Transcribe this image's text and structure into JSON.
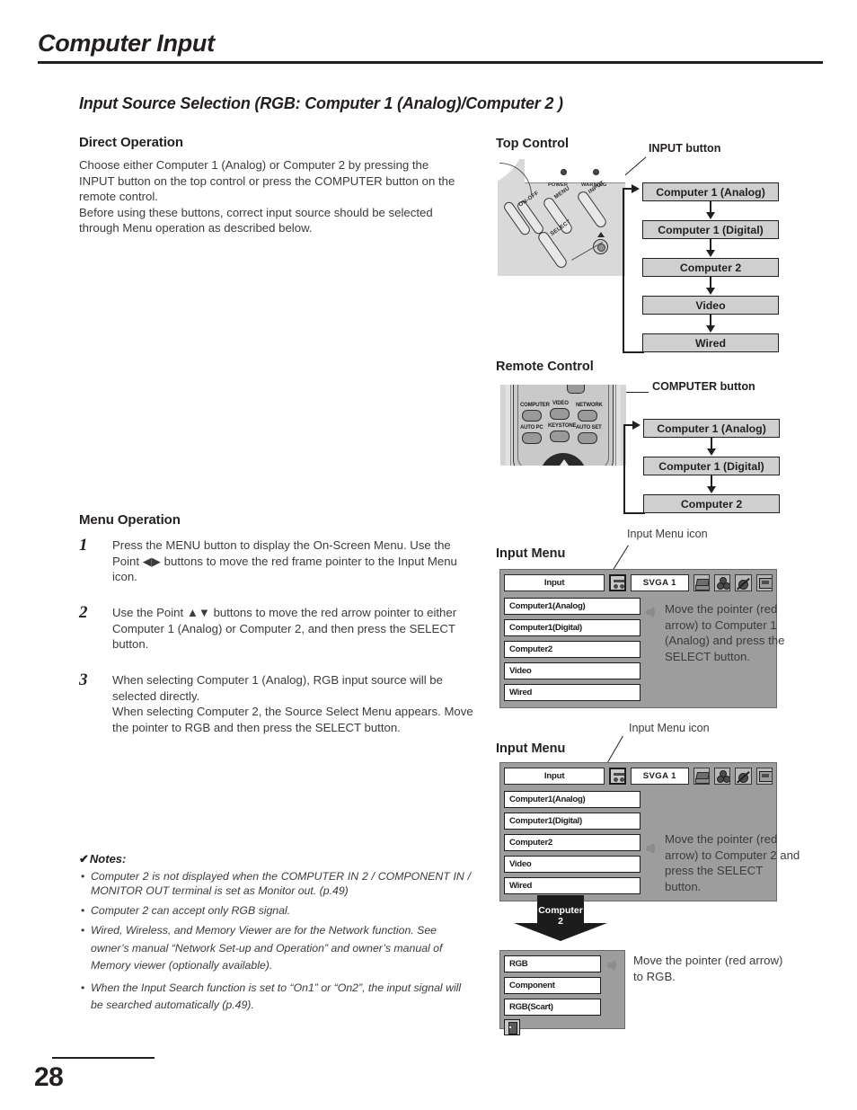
{
  "page": {
    "title": "Computer Input",
    "number": "28"
  },
  "section": {
    "heading": "Input Source Selection (RGB: Computer 1 (Analog)/Computer 2 )"
  },
  "direct_operation": {
    "heading": "Direct Operation",
    "body": "Choose either Computer 1 (Analog) or Computer 2 by pressing the INPUT button on the top control or press the COMPUTER button on the remote control.\nBefore using these buttons, correct input source should be selected through Menu operation as described below."
  },
  "menu_operation": {
    "heading": "Menu Operation",
    "steps": [
      {
        "num": "1",
        "text": "Press the MENU button to display the On-Screen Menu. Use the Point ◀▶ buttons to move the red frame pointer to the Input Menu icon."
      },
      {
        "num": "2",
        "text": "Use the Point ▲▼ buttons to move the red arrow pointer to either Computer 1 (Analog) or Computer 2, and then press the SELECT button."
      },
      {
        "num": "3",
        "text": "When selecting Computer 1 (Analog), RGB input source will be selected directly.\nWhen selecting Computer 2, the Source Select Menu appears. Move the pointer to RGB and then press the SELECT button."
      }
    ]
  },
  "notes": {
    "title": "Notes:",
    "check": "✔",
    "items": [
      "Computer 2 is not displayed when the COMPUTER IN 2 / COMPONENT IN / MONITOR OUT terminal is set as Monitor out. (p.49)",
      "Computer 2 can accept only RGB signal.",
      "Wired, Wireless, and Memory Viewer are for the Network function. See owner’s manual “Network Set-up and Operation” and owner’s manual of Memory viewer (optionally available).",
      "When the Input Search function is set to “On1” or “On2”, the input signal will be searched automatically (p.49)."
    ]
  },
  "top_control": {
    "heading": "Top Control",
    "callout": "INPUT button",
    "leds": [
      {
        "label": "POWER"
      },
      {
        "label": "WARNING"
      }
    ],
    "keys": [
      {
        "label": "ON-OFF"
      },
      {
        "label": "MENU"
      },
      {
        "label": "INPUT"
      },
      {
        "label": "SELECT"
      }
    ],
    "flow": [
      "Computer 1 (Analog)",
      "Computer 1 (Digital)",
      "Computer 2",
      "Video",
      "Wired"
    ]
  },
  "remote_control": {
    "heading": "Remote Control",
    "callout": "COMPUTER button",
    "keys": [
      {
        "label": "COMPUTER"
      },
      {
        "label": "VIDEO"
      },
      {
        "label": "NETWORK"
      },
      {
        "label": "AUTO PC"
      },
      {
        "label": "KEYSTONE"
      },
      {
        "label": "AUTO SET"
      }
    ],
    "flow": [
      "Computer 1 (Analog)",
      "Computer 1 (Digital)",
      "Computer 2"
    ]
  },
  "input_menu_1": {
    "heading": "Input Menu",
    "icon_callout": "Input Menu icon",
    "bar": {
      "input_label": "Input",
      "signal_label": "SVGA 1",
      "icons": [
        "input-source-icon",
        "pc-adjust-icon",
        "image-select-icon",
        "image-adjust-icon",
        "screen-icon"
      ]
    },
    "items": [
      {
        "label": "Computer1(Analog)",
        "pointer": true
      },
      {
        "label": "Computer1(Digital)",
        "pointer": false
      },
      {
        "label": "Computer2",
        "pointer": false
      },
      {
        "label": "Video",
        "pointer": false
      },
      {
        "label": "Wired",
        "pointer": false
      }
    ],
    "description": "Move the pointer (red arrow) to Computer 1 (Analog) and press the SELECT button."
  },
  "input_menu_2": {
    "heading": "Input Menu",
    "icon_callout": "Input Menu icon",
    "bar": {
      "input_label": "Input",
      "signal_label": "SVGA 1"
    },
    "items": [
      {
        "label": "Computer1(Analog)",
        "pointer": false
      },
      {
        "label": "Computer1(Digital)",
        "pointer": false
      },
      {
        "label": "Computer2",
        "pointer": true
      },
      {
        "label": "Video",
        "pointer": false
      },
      {
        "label": "Wired",
        "pointer": false
      }
    ],
    "description": "Move the pointer (red arrow) to Computer 2 and press the SELECT button."
  },
  "transition_arrow": {
    "label_line1": "Computer",
    "label_line2": "2"
  },
  "source_select_menu": {
    "items": [
      {
        "label": "RGB",
        "pointer": true
      },
      {
        "label": "Component",
        "pointer": false
      },
      {
        "label": "RGB(Scart)",
        "pointer": false
      }
    ],
    "exit_icon": "exit-icon",
    "description": "Move the pointer (red arrow) to RGB."
  },
  "colors": {
    "ink": "#231f20",
    "body_text": "#3b3b3b",
    "flow_box_fill": "#cfcfcf",
    "osd_panel": "#9d9d9d",
    "osd_item": "#ffffff"
  }
}
